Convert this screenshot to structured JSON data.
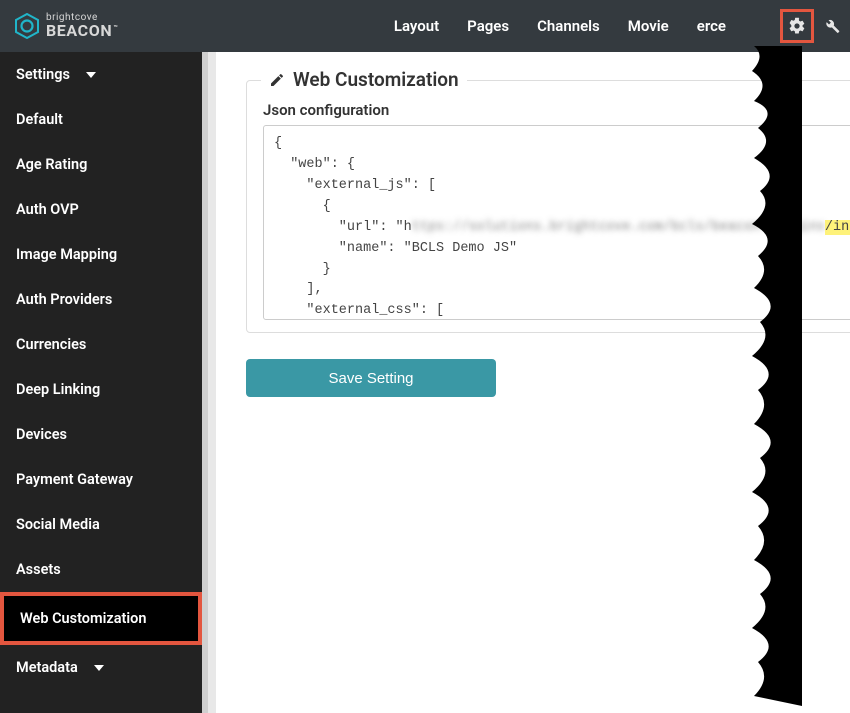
{
  "brand": {
    "top": "brightcove",
    "bottom": "BEACON",
    "tm": "™"
  },
  "nav": {
    "items": [
      "Layout",
      "Pages",
      "Channels",
      "Movie",
      "erce"
    ]
  },
  "sidebar": {
    "header": "Settings",
    "items": [
      "Default",
      "Age Rating",
      "Auth OVP",
      "Image Mapping",
      "Auth Providers",
      "Currencies",
      "Deep Linking",
      "Devices",
      "Payment Gateway",
      "Social Media",
      "Assets",
      "Web Customization"
    ],
    "footer": "Metadata"
  },
  "panel": {
    "title": "Web Customization",
    "field_label": "Json configuration",
    "save_label": "Save Setting"
  },
  "json": {
    "l0": "{",
    "l1": "  \"web\": {",
    "l2": "    \"external_js\": [",
    "l3": "      {",
    "l4a": "        \"url\": \"h",
    "l4_blur": "ttps://solutions.brightcove.com/bcls/beacon-plugins",
    "l4_hl": "/index.js",
    "l4b": "\",",
    "l5": "        \"name\": \"BCLS Demo JS\"",
    "l6": "      }",
    "l7": "    ],",
    "l8": "    \"external_css\": [",
    "l9": "      {"
  }
}
